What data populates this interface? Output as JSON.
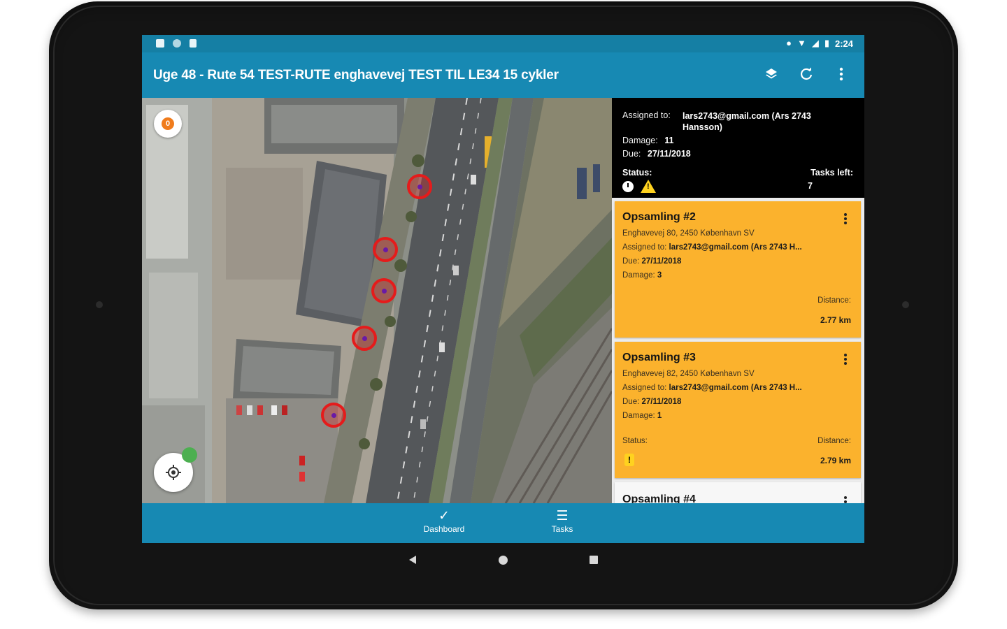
{
  "status_bar": {
    "time": "2:24",
    "icons": [
      "notification-icon",
      "sync-icon",
      "sd-card-icon",
      "location-icon",
      "wifi-icon",
      "signal-icon",
      "battery-icon"
    ]
  },
  "app_bar": {
    "title": "Uge 48 - Rute 54 TEST-RUTE enghavevej TEST TIL LE34 15 cykler",
    "actions": [
      "layers-icon",
      "refresh-icon",
      "more-vert-icon"
    ]
  },
  "map": {
    "compass_label": "0",
    "marker_count": 5
  },
  "route_info": {
    "assigned_label": "Assigned to:",
    "assigned_value": "lars2743@gmail.com (Ars 2743 Hansson)",
    "damage_label": "Damage:",
    "damage_value": "11",
    "due_label": "Due:",
    "due_value": "27/11/2018",
    "status_label": "Status:",
    "tasks_left_label": "Tasks left:",
    "tasks_left_value": "7"
  },
  "tasks": [
    {
      "title": "Opsamling #2",
      "address": "Enghavevej 80, 2450 København SV",
      "assigned_label": "Assigned to:",
      "assigned_value": "lars2743@gmail.com (Ars 2743 H...",
      "due_label": "Due:",
      "due_value": "27/11/2018",
      "damage_label": "Damage:",
      "damage_value": "3",
      "distance_label": "Distance:",
      "distance_value": "2.77 km"
    },
    {
      "title": "Opsamling #3",
      "address": "Enghavevej 82, 2450 København SV",
      "assigned_label": "Assigned to:",
      "assigned_value": "lars2743@gmail.com (Ars 2743 H...",
      "due_label": "Due:",
      "due_value": "27/11/2018",
      "damage_label": "Damage:",
      "damage_value": "1",
      "status_label": "Status:",
      "status_warning": "!",
      "distance_label": "Distance:",
      "distance_value": "2.79 km"
    },
    {
      "title": "Opsamling #4"
    }
  ],
  "bottom_nav": {
    "dashboard_label": "Dashboard",
    "tasks_label": "Tasks"
  },
  "colors": {
    "status_bar": "#157fa4",
    "app_bar": "#1789b3",
    "card": "#fbb22d",
    "marker": "#e51b1b"
  }
}
